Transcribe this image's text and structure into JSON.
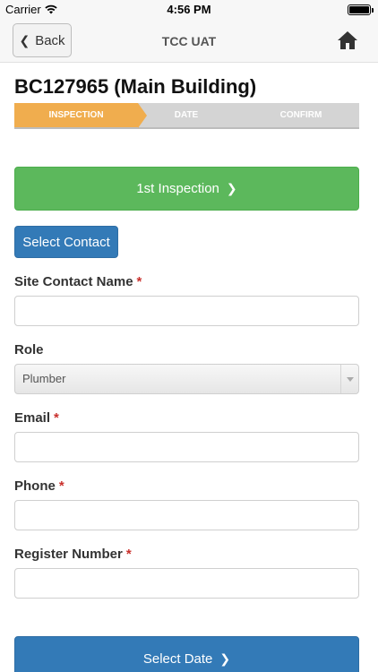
{
  "status_bar": {
    "carrier": "Carrier",
    "time": "4:56 PM"
  },
  "navbar": {
    "back_label": "Back",
    "title": "TCC UAT"
  },
  "page": {
    "title": "BC127965 (Main Building)"
  },
  "steps": [
    {
      "label": "INSPECTION",
      "active": true
    },
    {
      "label": "DATE",
      "active": false
    },
    {
      "label": "CONFIRM",
      "active": false
    }
  ],
  "buttons": {
    "inspection": "1st Inspection",
    "select_contact": "Select Contact",
    "select_date": "Select Date"
  },
  "form": {
    "site_contact_name": {
      "label": "Site Contact Name",
      "required": "*",
      "value": ""
    },
    "role": {
      "label": "Role",
      "selected": "Plumber"
    },
    "email": {
      "label": "Email",
      "required": "*",
      "value": ""
    },
    "phone": {
      "label": "Phone",
      "required": "*",
      "value": ""
    },
    "register_number": {
      "label": "Register Number",
      "required": "*",
      "value": ""
    }
  },
  "colors": {
    "step_active": "#f0ad4e",
    "success": "#5cb85c",
    "primary": "#337ab7",
    "required": "#c9302c"
  }
}
